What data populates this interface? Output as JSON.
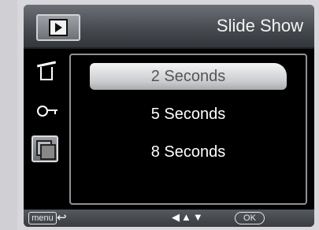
{
  "header": {
    "title": "Slide Show",
    "mode_icon": "playback-icon"
  },
  "sidebar": {
    "items": [
      {
        "icon": "delete-icon"
      },
      {
        "icon": "protect-key-icon"
      },
      {
        "icon": "slideshow-icon",
        "active": true
      }
    ]
  },
  "options": {
    "items": [
      {
        "label": "2 Seconds",
        "selected": true
      },
      {
        "label": "5 Seconds",
        "selected": false
      },
      {
        "label": "8 Seconds",
        "selected": false
      }
    ]
  },
  "footer": {
    "menu_label": "menu",
    "back_icon": "back-arrow-icon",
    "nav_icon": "left-up-down-arrows-icon",
    "ok_label": "OK"
  }
}
